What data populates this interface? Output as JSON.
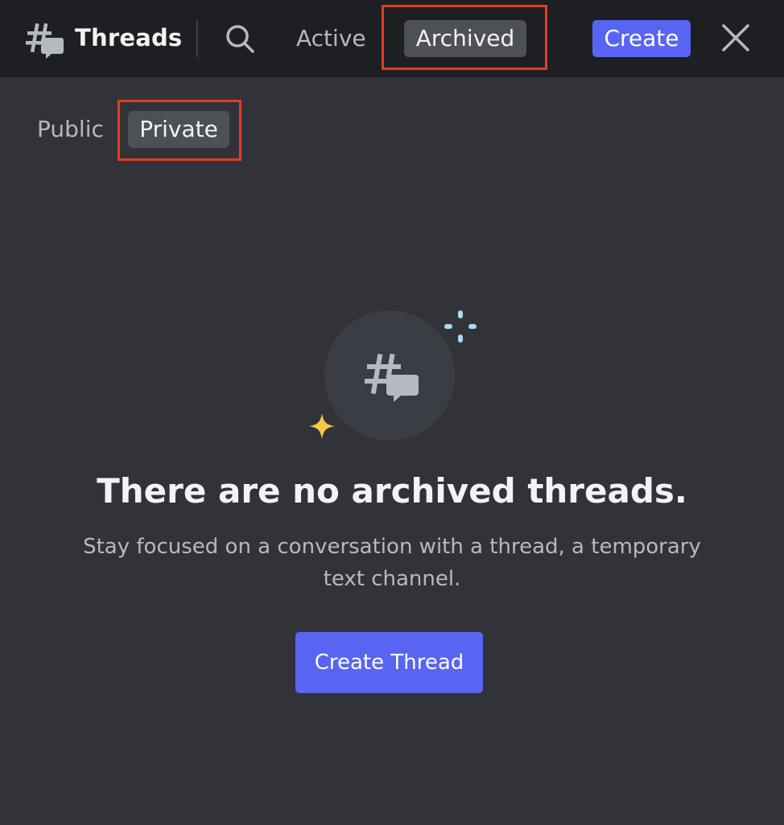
{
  "header": {
    "title": "Threads",
    "icon": "threads-icon",
    "tabs": [
      {
        "label": "Active",
        "selected": false
      },
      {
        "label": "Archived",
        "selected": true
      }
    ],
    "create_label": "Create",
    "search_icon": "search-icon",
    "close_icon": "close-icon"
  },
  "subtabs": [
    {
      "label": "Public",
      "selected": false
    },
    {
      "label": "Private",
      "selected": true
    }
  ],
  "empty_state": {
    "icon": "threads-icon",
    "title": "There are no archived threads.",
    "description": "Stay focused on a conversation with a thread, a temporary text channel.",
    "button_label": "Create Thread"
  },
  "colors": {
    "accent": "#5865f2",
    "highlight": "#e53b24",
    "background": "#313338",
    "header_background": "#1e1f22",
    "sparkle_blue": "#a7dcf2",
    "sparkle_yellow": "#f6c844"
  }
}
